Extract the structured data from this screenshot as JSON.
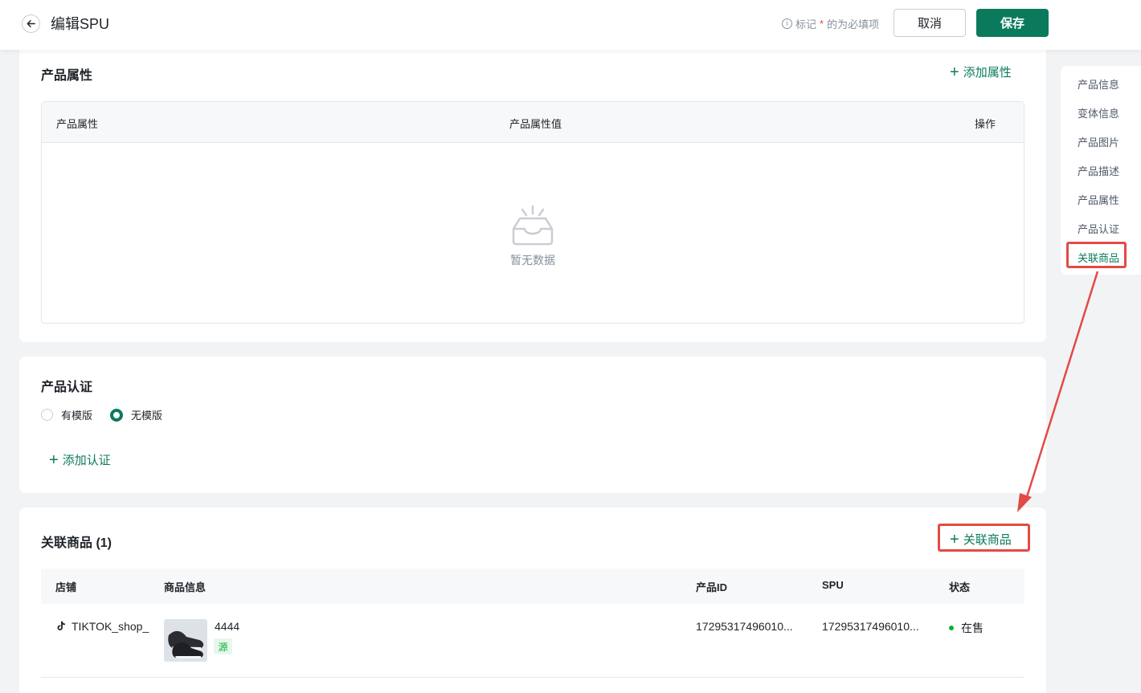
{
  "header": {
    "title": "编辑SPU",
    "hint_prefix": "标记",
    "hint_star": "*",
    "hint_suffix": "的为必填项",
    "cancel_label": "取消",
    "save_label": "保存"
  },
  "attributes": {
    "title": "产品属性",
    "add_label": "添加属性",
    "columns": [
      "产品属性",
      "产品属性值",
      "操作"
    ],
    "empty_text": "暂无数据"
  },
  "certification": {
    "title": "产品认证",
    "options": [
      "有模版",
      "无模版"
    ],
    "selected": "无模版",
    "add_label": "添加认证"
  },
  "linked": {
    "title": "关联商品 (1)",
    "add_label": "关联商品",
    "columns": [
      "店铺",
      "商品信息",
      "产品ID",
      "SPU",
      "状态"
    ],
    "rows": [
      {
        "shop": "TIKTOK_shop_",
        "name": "4444",
        "tag": "源",
        "product_id": "17295317496010...",
        "spu": "17295317496010...",
        "status": "在售"
      }
    ]
  },
  "side_nav": {
    "items": [
      "产品信息",
      "变体信息",
      "产品图片",
      "产品描述",
      "产品属性",
      "产品认证",
      "关联商品"
    ],
    "active": "关联商品"
  },
  "colors": {
    "brand": "#0b7a5c",
    "annotation": "#e34a45",
    "status_on_sale": "#00b42a"
  }
}
